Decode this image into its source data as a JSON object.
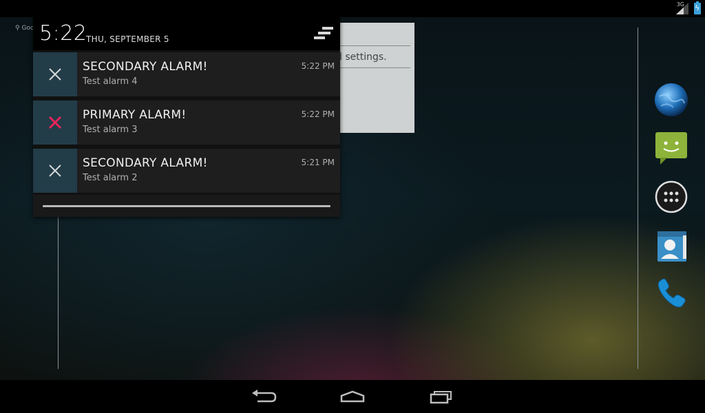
{
  "status_bar": {
    "network_type": "3G",
    "battery_icon": "battery-charging-icon",
    "signal_icon": "signal-icon"
  },
  "home": {
    "search_hint": "Goo",
    "background_dialog_text": "d settings."
  },
  "shade": {
    "time": "5:22",
    "date": "THU, SEPTEMBER 5",
    "clear_icon": "clear-all-icon"
  },
  "notifications": [
    {
      "title": "SECONDARY ALARM!",
      "text": "Test alarm 4",
      "time": "5:22 PM",
      "icon": "close-icon",
      "icon_color": "#d8d8d8"
    },
    {
      "title": "PRIMARY ALARM!",
      "text": "Test alarm 3",
      "time": "5:22 PM",
      "icon": "close-icon",
      "icon_color": "#e8245a"
    },
    {
      "title": "SECONDARY ALARM!",
      "text": "Test alarm 2",
      "time": "5:21 PM",
      "icon": "close-icon",
      "icon_color": "#d8d8d8"
    }
  ],
  "dock": [
    "browser-icon",
    "messaging-icon",
    "app-drawer-icon",
    "contacts-icon",
    "phone-icon"
  ],
  "nav": [
    "back-icon",
    "home-icon",
    "recent-apps-icon"
  ],
  "colors": {
    "notif_icon_bg": "#223c48",
    "accent_pink": "#e8245a",
    "holo_blue": "#3ca0d8"
  }
}
